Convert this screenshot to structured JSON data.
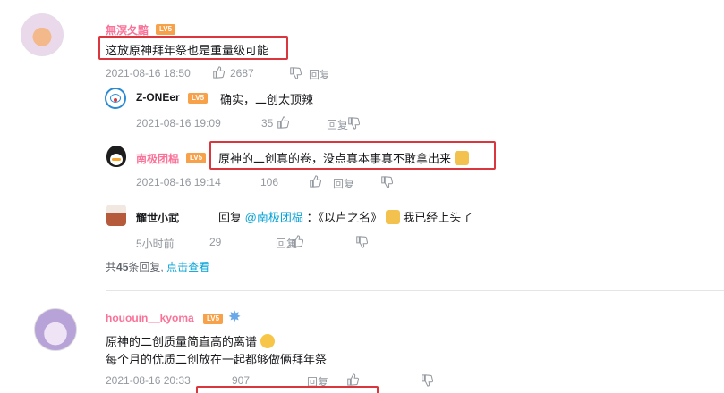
{
  "comments": [
    {
      "username": "無溟夂黯",
      "level": "LV5",
      "text": "这放原神拜年祭也是重量级可能",
      "date": "2021-08-16 18:50",
      "likes": "2687",
      "reply_label": "回复",
      "replies": [
        {
          "username": "Z-ONEer",
          "level": "LV5",
          "text": "确实，二创太顶辣",
          "date": "2021-08-16 19:09",
          "likes": "35",
          "reply_label": "回复"
        },
        {
          "username": "南极团榀",
          "level": "LV5",
          "text": "原神的二创真的卷，没点真本事真不敢拿出来",
          "date": "2021-08-16 19:14",
          "likes": "106",
          "reply_label": "回复"
        },
        {
          "username": "耀世小武",
          "reply_prefix": "回复",
          "mention": "@南极团榀",
          "text": "：《以卢之名》",
          "text_suffix": "我已经上头了",
          "date": "5小时前",
          "likes": "29",
          "reply_label": "回复"
        }
      ],
      "more_replies": {
        "prefix": "共",
        "count": "45",
        "suffix": "条回复,",
        "link": "点击查看"
      }
    },
    {
      "username": "hououin__kyoma",
      "level": "LV5",
      "text_line1": "原神的二创质量简直高的离谱",
      "text_line2": "每个月的优质二创放在一起都够做俩拜年祭",
      "date": "2021-08-16 20:33",
      "likes": "907",
      "reply_label": "回复"
    }
  ],
  "colors": {
    "username_pink": "#fb7299",
    "meta_gray": "#9499a0",
    "highlight_red": "#d9363e",
    "link_blue": "#00a1d6",
    "level_orange": "#f7a24a"
  }
}
